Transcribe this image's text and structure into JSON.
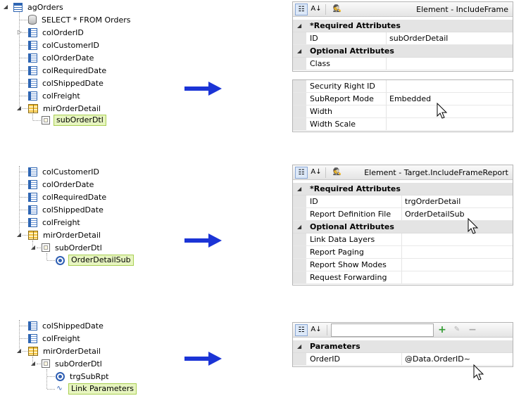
{
  "tree1": {
    "root": "agOrders",
    "query": "SELECT * FROM Orders",
    "cols": [
      "colOrderID",
      "colCustomerID",
      "colOrderDate",
      "colRequiredDate",
      "colShippedDate",
      "colFreight"
    ],
    "mirror": "mirOrderDetail",
    "frame": "subOrderDtl"
  },
  "tree2": {
    "cols": [
      "colCustomerID",
      "colOrderDate",
      "colRequiredDate",
      "colShippedDate",
      "colFreight"
    ],
    "mirror": "mirOrderDetail",
    "frame": "subOrderDtl",
    "target": "OrderDetailSub"
  },
  "tree3": {
    "cols": [
      "colShippedDate",
      "colFreight"
    ],
    "mirror": "mirOrderDetail",
    "frame": "subOrderDtl",
    "target": "trgSubRpt",
    "params": "Link Parameters"
  },
  "panel1": {
    "title": "Element - IncludeFrame",
    "required_header": "*Required Attributes",
    "rows_required": [
      {
        "name": "ID",
        "value": "subOrderDetail"
      }
    ],
    "optional_header": "Optional Attributes",
    "rows_optional": [
      {
        "name": "Class",
        "value": ""
      }
    ],
    "rows_more": [
      {
        "name": "Security Right ID",
        "value": ""
      },
      {
        "name": "SubReport Mode",
        "value": "Embedded"
      },
      {
        "name": "Width",
        "value": ""
      },
      {
        "name": "Width Scale",
        "value": ""
      }
    ]
  },
  "panel2": {
    "title": "Element - Target.IncludeFrameReport",
    "required_header": "*Required Attributes",
    "rows_required": [
      {
        "name": "ID",
        "value": "trgOrderDetail"
      },
      {
        "name": "Report Definition File",
        "value": "OrderDetailSub"
      }
    ],
    "optional_header": "Optional Attributes",
    "rows_optional": [
      {
        "name": "Link Data Layers",
        "value": ""
      },
      {
        "name": "Report Paging",
        "value": ""
      },
      {
        "name": "Report Show Modes",
        "value": ""
      },
      {
        "name": "Request Forwarding",
        "value": ""
      }
    ]
  },
  "panel3": {
    "params_header": "Parameters",
    "rows": [
      {
        "name": "OrderID",
        "value": "@Data.OrderID~"
      }
    ],
    "add": "+",
    "remove": "−"
  },
  "colors": {
    "arrow": "#1b34d6",
    "selection": "#e7f5c0",
    "selection_border": "#a9cf52"
  }
}
